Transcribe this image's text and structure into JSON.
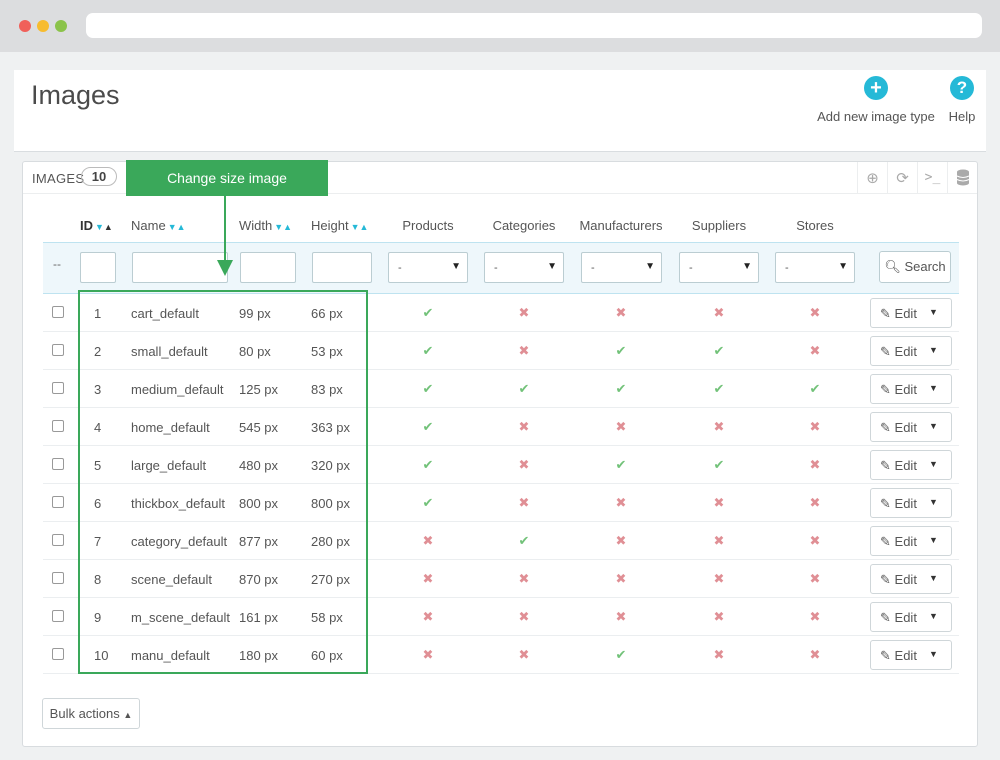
{
  "header": {
    "title": "Images",
    "add_label": "Add new image type",
    "add_icon": "plus-circle-icon",
    "help_label": "Help",
    "help_icon": "question-circle-icon"
  },
  "panel": {
    "title": "IMAGES",
    "count": "10"
  },
  "columns": {
    "id": "ID",
    "name": "Name",
    "width": "Width",
    "height": "Height",
    "products": "Products",
    "categories": "Categories",
    "manufacturers": "Manufacturers",
    "suppliers": "Suppliers",
    "stores": "Stores"
  },
  "filters": {
    "dash": "--",
    "select_value": "-",
    "search_label": "Search"
  },
  "rows": [
    {
      "id": "1",
      "name": "cart_default",
      "width": "99 px",
      "height": "66 px",
      "products": true,
      "categories": false,
      "manufacturers": false,
      "suppliers": false,
      "stores": false
    },
    {
      "id": "2",
      "name": "small_default",
      "width": "80 px",
      "height": "53 px",
      "products": true,
      "categories": false,
      "manufacturers": true,
      "suppliers": true,
      "stores": false
    },
    {
      "id": "3",
      "name": "medium_default",
      "width": "125 px",
      "height": "83 px",
      "products": true,
      "categories": true,
      "manufacturers": true,
      "suppliers": true,
      "stores": true
    },
    {
      "id": "4",
      "name": "home_default",
      "width": "545 px",
      "height": "363 px",
      "products": true,
      "categories": false,
      "manufacturers": false,
      "suppliers": false,
      "stores": false
    },
    {
      "id": "5",
      "name": "large_default",
      "width": "480 px",
      "height": "320 px",
      "products": true,
      "categories": false,
      "manufacturers": true,
      "suppliers": true,
      "stores": false
    },
    {
      "id": "6",
      "name": "thickbox_default",
      "width": "800 px",
      "height": "800 px",
      "products": true,
      "categories": false,
      "manufacturers": false,
      "suppliers": false,
      "stores": false
    },
    {
      "id": "7",
      "name": "category_default",
      "width": "877 px",
      "height": "280 px",
      "products": false,
      "categories": true,
      "manufacturers": false,
      "suppliers": false,
      "stores": false
    },
    {
      "id": "8",
      "name": "scene_default",
      "width": "870 px",
      "height": "270 px",
      "products": false,
      "categories": false,
      "manufacturers": false,
      "suppliers": false,
      "stores": false
    },
    {
      "id": "9",
      "name": "m_scene_default",
      "width": "161 px",
      "height": "58 px",
      "products": false,
      "categories": false,
      "manufacturers": false,
      "suppliers": false,
      "stores": false
    },
    {
      "id": "10",
      "name": "manu_default",
      "width": "180 px",
      "height": "60 px",
      "products": false,
      "categories": false,
      "manufacturers": true,
      "suppliers": false,
      "stores": false
    }
  ],
  "row_actions": {
    "edit_label": "Edit"
  },
  "footer": {
    "bulk_label": "Bulk actions"
  },
  "annotation": {
    "label": "Change size image",
    "color": "#3aa85a"
  },
  "colors": {
    "accent": "#25b9d7",
    "check": "#72c279",
    "cross": "#e08f95"
  }
}
